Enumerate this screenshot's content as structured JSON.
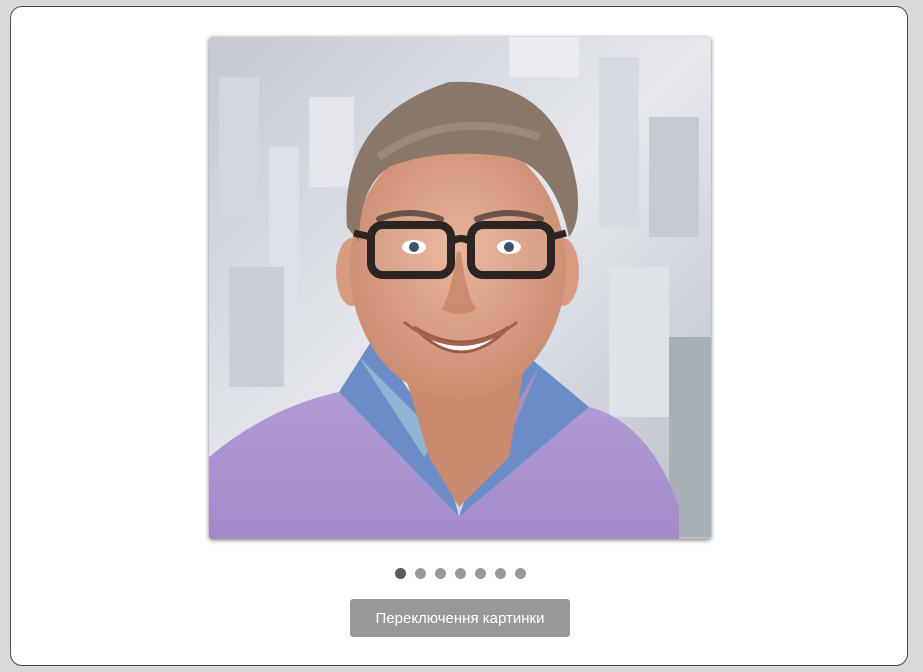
{
  "carousel": {
    "image_alt": "Portrait of a smiling man with glasses in a lavender sweater",
    "dot_count": 7,
    "active_index": 0,
    "button_label": "Переключення картинки"
  },
  "colors": {
    "dot_active": "#5a5a5a",
    "dot_inactive": "#9a9a9a",
    "button_bg": "#9a9898"
  }
}
